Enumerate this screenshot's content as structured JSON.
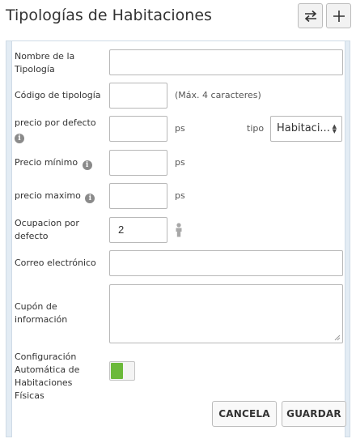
{
  "header": {
    "title": "Tipologías de Habitaciones",
    "swap_button_icon": "swap-arrows-icon",
    "add_button_icon": "plus-icon"
  },
  "form": {
    "name_label": "Nombre de la Tipología",
    "name_value": "",
    "code_label": "Código de tipología",
    "code_value": "",
    "code_hint": "(Máx. 4 caracteres)",
    "default_price_label": "precio por defecto",
    "default_price_value": "",
    "default_price_unit": "ps",
    "type_label": "tipo",
    "type_selected": "Habitaci...",
    "min_price_label": "Precio mínimo",
    "min_price_value": "",
    "min_price_unit": "ps",
    "max_price_label": "precio maximo",
    "max_price_value": "",
    "max_price_unit": "ps",
    "occupancy_label": "Ocupacion por defecto",
    "occupancy_value": "2",
    "occupancy_icon": "person-icon",
    "email_label": "Correo electrónico",
    "email_value": "",
    "voucher_label": "Cupón de información",
    "voucher_value": "",
    "autoconfig_label": "Configuración Automática de Habitaciones Físicas",
    "autoconfig_enabled": true,
    "info_icon": "info-icon"
  },
  "actions": {
    "cancel_label": "CANCELA",
    "save_label": "GUARDAR"
  },
  "colors": {
    "panel_bg": "#e3ecf4",
    "toggle_on": "#6bb93a"
  }
}
